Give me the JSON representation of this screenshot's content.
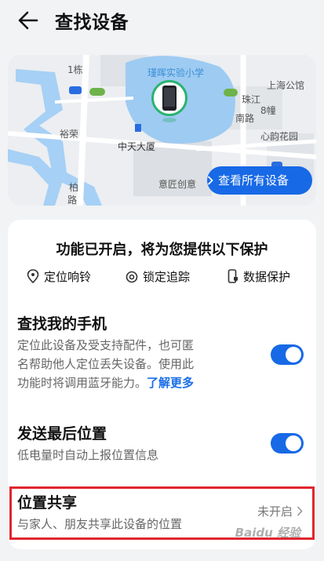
{
  "header": {
    "title": "查找设备"
  },
  "map": {
    "labels": {
      "school": "瑾晖实验小学",
      "num": "1栋",
      "shanghai": "上海公馆",
      "zhujiang": "珠江",
      "nanlu": "南路",
      "eight": "8幢",
      "xinyi": "心韵花园",
      "yuhe": "裕荣",
      "dasha": "中天大厦",
      "bai": "柏",
      "road": "路",
      "creative": "意匠创意"
    },
    "all_devices_label": "查看所有设备"
  },
  "protection": {
    "title": "功能已开启，将为您提供以下保护",
    "features": [
      "定位响铃",
      "锁定追踪",
      "数据保护"
    ]
  },
  "find_phone": {
    "title": "查找我的手机",
    "desc_line1": "定位此设备及受支持配件，也可匿",
    "desc_line2": "名帮助他人定位丢失设备。使用此",
    "desc_line3": "功能时将调用蓝牙能力。",
    "link": "了解更多",
    "enabled": true
  },
  "last_location": {
    "title": "发送最后位置",
    "desc": "低电量时自动上报位置信息",
    "enabled": true
  },
  "location_sharing": {
    "title": "位置共享",
    "desc": "与家人、朋友共享此设备的位置",
    "status": "未开启"
  },
  "watermark": "Baidu 经验",
  "colors": {
    "accent": "#1769e6",
    "highlight": "#e0262f",
    "pin": "#2ab36f"
  }
}
